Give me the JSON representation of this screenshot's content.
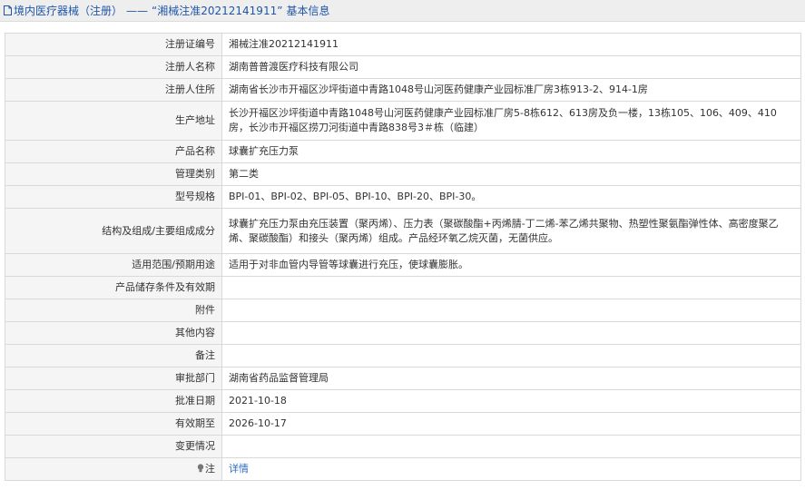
{
  "header": {
    "category": "境内医疗器械（注册）",
    "separator": "——",
    "record": "“湘械注准20212141911”",
    "suffix": "基本信息"
  },
  "rows": [
    {
      "label": "注册证编号",
      "value": "湘械注准20212141911"
    },
    {
      "label": "注册人名称",
      "value": "湖南普普渡医疗科技有限公司"
    },
    {
      "label": "注册人住所",
      "value": "湖南省长沙市开福区沙坪街道中青路1048号山河医药健康产业园标准厂房3栋913-2、914-1房"
    },
    {
      "label": "生产地址",
      "value": "长沙开福区沙坪街道中青路1048号山河医药健康产业园标准厂房5-8栋612、613房及负一楼，13栋105、106、409、410房，长沙市开福区捞刀河街道中青路838号3＃栋（临建）"
    },
    {
      "label": "产品名称",
      "value": "球囊扩充压力泵"
    },
    {
      "label": "管理类别",
      "value": "第二类"
    },
    {
      "label": "型号规格",
      "value": "BPI-01、BPI-02、BPI-05、BPI-10、BPI-20、BPI-30。"
    },
    {
      "label": "结构及组成/主要组成成分",
      "value": "球囊扩充压力泵由充压装置（聚丙烯）、压力表（聚碳酸酯+丙烯腈-丁二烯-苯乙烯共聚物、热塑性聚氨酯弹性体、高密度聚乙烯、聚碳酸酯）和接头（聚丙烯）组成。产品经环氧乙烷灭菌，无菌供应。"
    },
    {
      "label": "适用范围/预期用途",
      "value": "适用于对非血管内导管等球囊进行充压，使球囊膨胀。"
    },
    {
      "label": "产品储存条件及有效期",
      "value": ""
    },
    {
      "label": "附件",
      "value": ""
    },
    {
      "label": "其他内容",
      "value": ""
    },
    {
      "label": "备注",
      "value": ""
    },
    {
      "label": "审批部门",
      "value": "湖南省药品监督管理局"
    },
    {
      "label": "批准日期",
      "value": "2021-10-18"
    },
    {
      "label": "有效期至",
      "value": "2026-10-17"
    },
    {
      "label": "变更情况",
      "value": ""
    }
  ],
  "note": {
    "label": "注",
    "link": "详情",
    "icon": "lightbulb-icon"
  },
  "colors": {
    "header_text": "#1f56a6",
    "link": "#2a6fc2",
    "label_bg": "#f5f5f5",
    "border": "#d9d9d9"
  }
}
